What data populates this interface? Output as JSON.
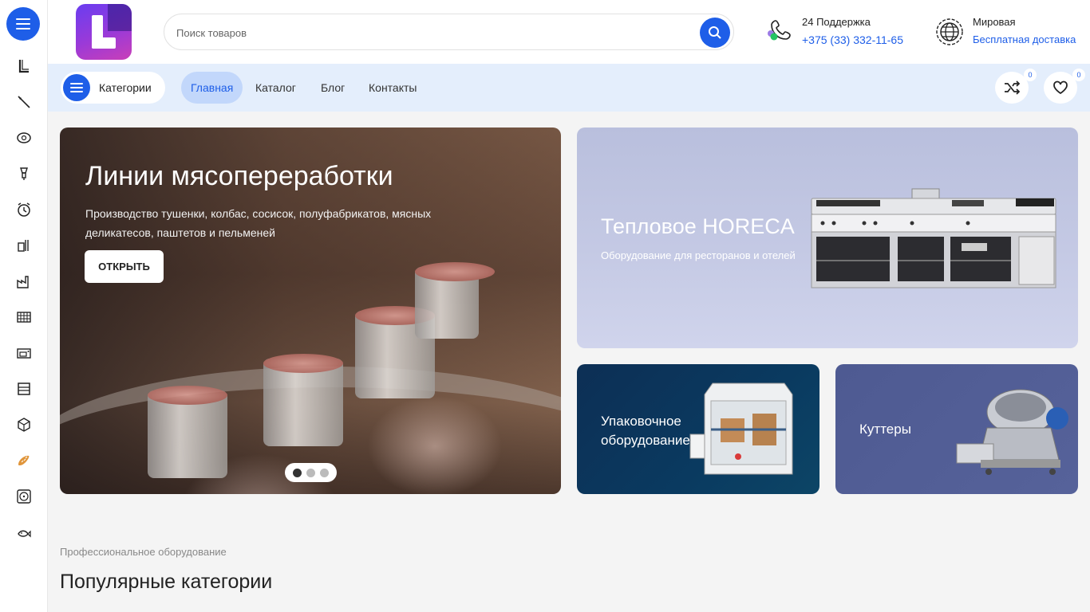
{
  "header": {
    "search_placeholder": "Поиск товаров",
    "support_label": "24 Поддержка",
    "support_phone": "+375 (33) 332-11-65",
    "delivery_label": "Мировая",
    "delivery_text": "Бесплатная доставка"
  },
  "nav": {
    "categories_label": "Категории",
    "links": [
      "Главная",
      "Каталог",
      "Блог",
      "Контакты"
    ],
    "compare_count": "0",
    "wishlist_count": "0"
  },
  "hero": {
    "title": "Линии мясопереработки",
    "description": "Производство тушенки, колбас, сосисок, полуфабрикатов,  мясных деликатесов, паштетов и пельменей",
    "button_label": "ОТКРЫТЬ",
    "active_slide": 1,
    "slides_count": 3
  },
  "banners": {
    "horeca_title": "Тепловое HORECA",
    "horeca_subtitle": "Оборудование для ресторанов и отелей",
    "packing_title": "Упаковочное оборудование",
    "cutters_title": "Куттеры"
  },
  "section": {
    "subtitle": "Профессиональное оборудование",
    "title": "Популярные категории"
  },
  "rail_icons": [
    "letter-l-icon",
    "knife-icon",
    "meat-icon",
    "grinder-icon",
    "clock-icon",
    "mixer-icon",
    "factory-icon",
    "grid-icon",
    "oven-icon",
    "shelf-icon",
    "box-icon",
    "bread-icon",
    "fan-icon",
    "fish-icon"
  ],
  "colors": {
    "accent": "#1e5ee8",
    "nav_bg": "#e4eefc",
    "active_nav": "#c2d7fb"
  }
}
